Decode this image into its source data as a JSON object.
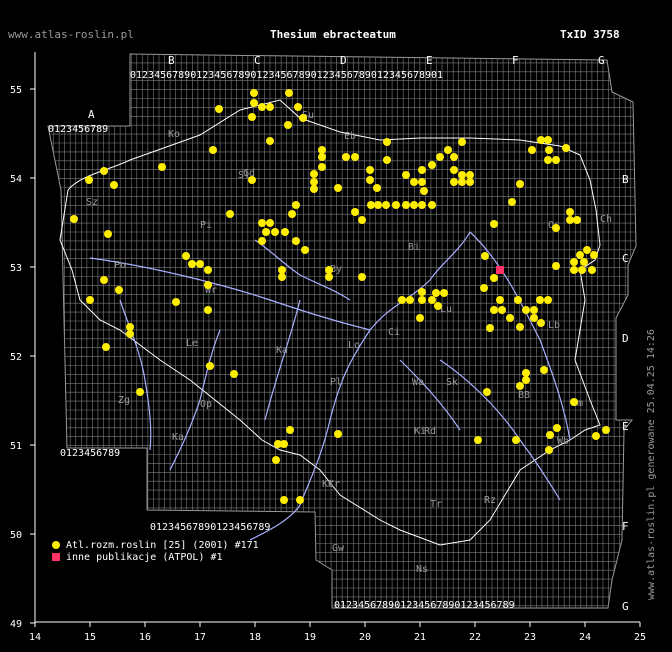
{
  "header": {
    "site": "www.atlas-roslin.pl",
    "title": "Thesium ebracteatum",
    "taxon_id": "TxID 3758"
  },
  "side_credit": "www.atlas-roslin.pl generowane 25.04.25 14:26",
  "legend": [
    {
      "label": "Atl.rozm.roslin [25] (2001) #171",
      "color": "#ffee00",
      "shape": "circle"
    },
    {
      "label": "inne publikacje (ATPOL) #1",
      "color": "#ff3366",
      "shape": "square"
    }
  ],
  "axes": {
    "x_ticks": [
      "14",
      "15",
      "16",
      "17",
      "18",
      "19",
      "20",
      "21",
      "22",
      "23",
      "24",
      "25"
    ],
    "y_ticks": [
      "55",
      "54",
      "53",
      "52",
      "51",
      "50",
      "49"
    ]
  },
  "atpol": {
    "top_letters": [
      "B",
      "C",
      "D",
      "E",
      "F",
      "G"
    ],
    "left_letter": "A",
    "right_letters": [
      "B",
      "C",
      "D",
      "E",
      "F",
      "G"
    ],
    "digits": "0123456789"
  },
  "region_labels": [
    "Ko",
    "Eb",
    "Pi",
    "Gd",
    "By",
    "Wr",
    "Sz",
    "Po",
    "Le",
    "Ka",
    "Lo",
    "Pl",
    "Bi",
    "Wa",
    "Ci",
    "Sk",
    "Rd",
    "Lu",
    "Ki",
    "Kr",
    "Tr",
    "Rz",
    "Ns",
    "Kt",
    "Op",
    "Zg",
    "Gw",
    "Ka",
    "BB",
    "Wb",
    "Lb",
    "Zm",
    "Os",
    "Ch",
    "Sl",
    "Su"
  ],
  "colors": {
    "yellow": "#ffee00",
    "pink": "#ff3366",
    "grid": "#8a8a8a",
    "river": "#a8b0ff"
  }
}
